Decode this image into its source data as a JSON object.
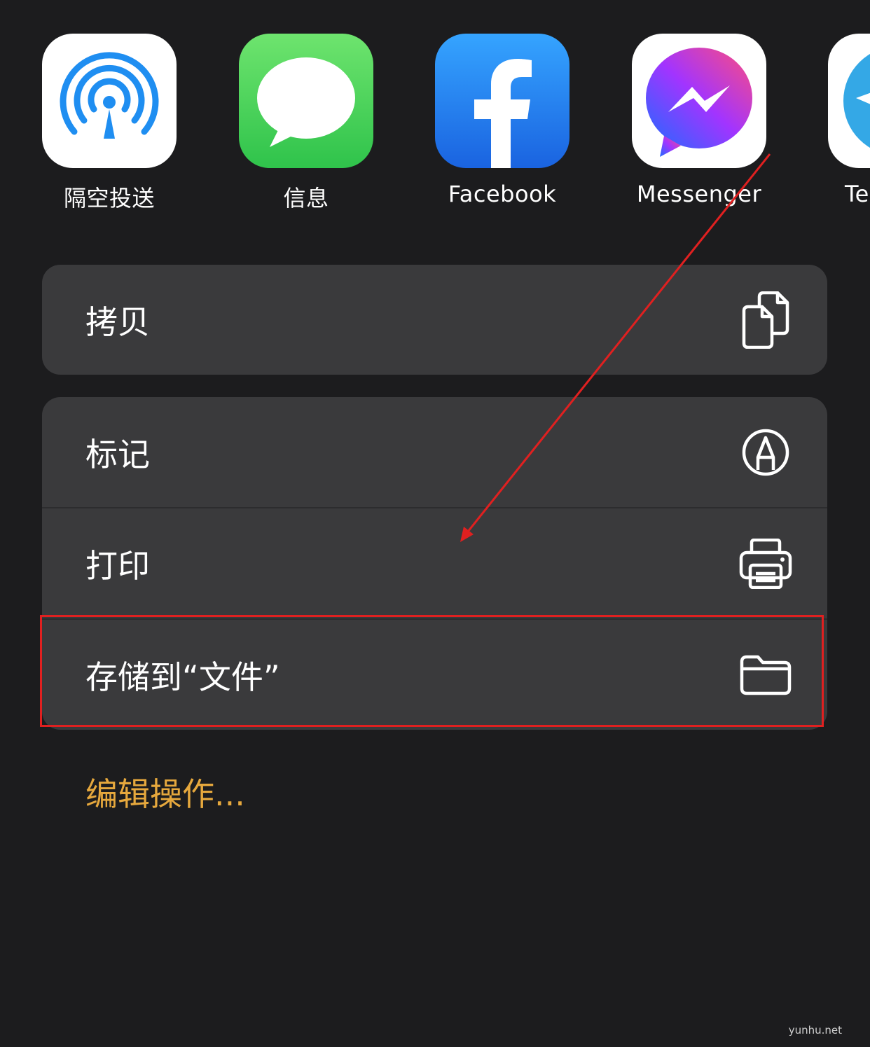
{
  "share_sheet": {
    "apps": [
      {
        "label": "隔空投送",
        "icon": "airdrop-icon"
      },
      {
        "label": "信息",
        "icon": "messages-icon"
      },
      {
        "label": "Facebook",
        "icon": "facebook-icon"
      },
      {
        "label": "Messenger",
        "icon": "messenger-icon"
      },
      {
        "label": "Te",
        "icon": "telegram-icon"
      }
    ],
    "actions_group_1": [
      {
        "label": "拷贝",
        "icon": "copy-icon"
      }
    ],
    "actions_group_2": [
      {
        "label": "标记",
        "icon": "markup-icon"
      },
      {
        "label": "打印",
        "icon": "print-icon"
      },
      {
        "label": "存储到“文件”",
        "icon": "folder-icon"
      }
    ],
    "edit_actions_label": "编辑操作...",
    "accent_color": "#e6a83d"
  },
  "watermark": "yunhu.net"
}
